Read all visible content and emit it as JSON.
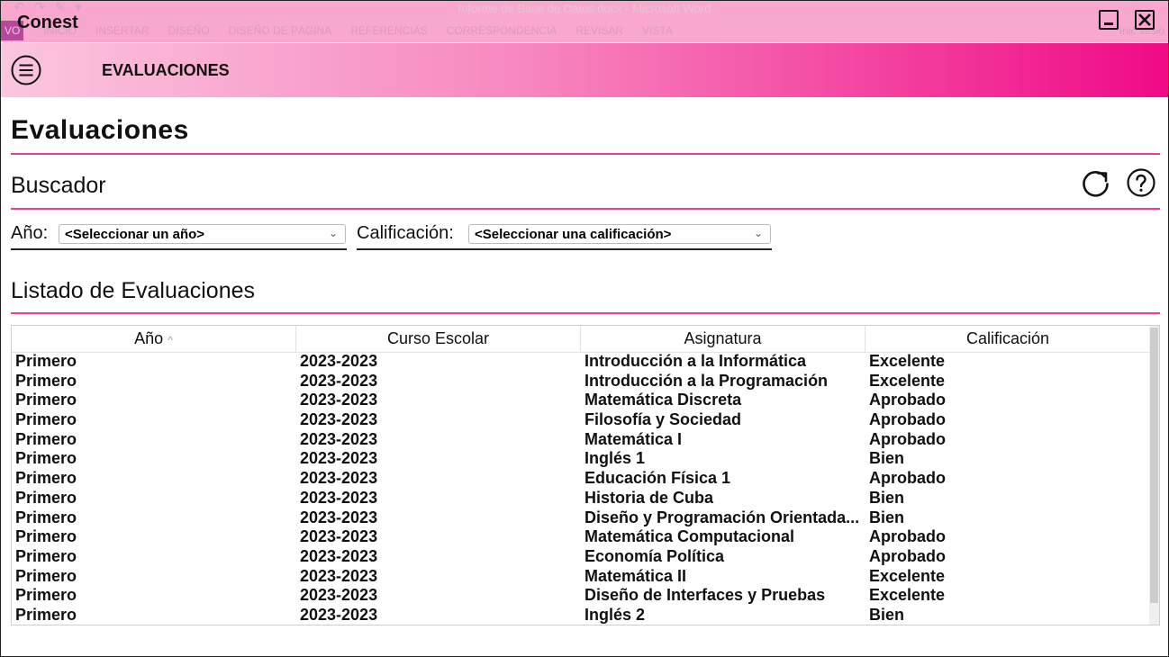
{
  "window": {
    "app_name": "Conest",
    "background_document_title": "Informe de Base de Datos.docx - Microsoft Word",
    "background_ribbon": {
      "file_tab": "VO",
      "tabs": [
        "INICIO",
        "INSERTAR",
        "DISEÑO",
        "DISEÑO DE PÁGINA",
        "REFERENCIAS",
        "CORRESPONDENCIA",
        "REVISAR",
        "VISTA"
      ],
      "right_text": "Inic sesió"
    }
  },
  "header": {
    "title": "EVALUACIONES"
  },
  "page": {
    "title": "Evaluaciones"
  },
  "search": {
    "title": "Buscador",
    "year_label": "Año:",
    "year_value": "<Seleccionar un año>",
    "grade_label": "Calificación:",
    "grade_value": "<Seleccionar una calificación>"
  },
  "list": {
    "title": "Listado de Evaluaciones",
    "columns": [
      "Año",
      "Curso Escolar",
      "Asignatura",
      "Calificación"
    ],
    "sort_indicator": "^",
    "rows": [
      [
        "Primero",
        "2023-2023",
        "Introducción a la Informática",
        "Excelente"
      ],
      [
        "Primero",
        "2023-2023",
        "Introducción a la Programación",
        "Excelente"
      ],
      [
        "Primero",
        "2023-2023",
        "Matemática Discreta",
        "Aprobado"
      ],
      [
        "Primero",
        "2023-2023",
        "Filosofía y Sociedad",
        "Aprobado"
      ],
      [
        "Primero",
        "2023-2023",
        "Matemática I",
        "Aprobado"
      ],
      [
        "Primero",
        "2023-2023",
        "Inglés 1",
        "Bien"
      ],
      [
        "Primero",
        "2023-2023",
        "Educación Física 1",
        "Aprobado"
      ],
      [
        "Primero",
        "2023-2023",
        "Historia de Cuba",
        "Bien"
      ],
      [
        "Primero",
        "2023-2023",
        "Diseño y Programación Orientada...",
        "Bien"
      ],
      [
        "Primero",
        "2023-2023",
        "Matemática Computacional",
        "Aprobado"
      ],
      [
        "Primero",
        "2023-2023",
        "Economía Política",
        "Aprobado"
      ],
      [
        "Primero",
        "2023-2023",
        "Matemática II",
        "Excelente"
      ],
      [
        "Primero",
        "2023-2023",
        "Diseño de Interfaces y Pruebas",
        "Excelente"
      ],
      [
        "Primero",
        "2023-2023",
        "Inglés 2",
        "Bien"
      ]
    ]
  },
  "icons": {
    "menu": "hamburger-menu-icon",
    "refresh": "refresh-icon",
    "help": "help-icon",
    "minimize": "minimize-icon",
    "close": "close-icon"
  },
  "colors": {
    "accent": "#e8409a",
    "banner_end": "#f00a86",
    "titlebar": "#f8a8cf"
  }
}
